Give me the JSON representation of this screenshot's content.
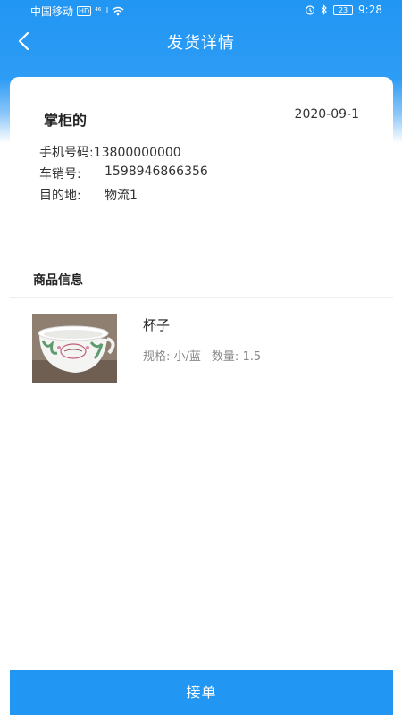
{
  "status_bar": {
    "carrier": "中国移动",
    "hd_badge": "HD",
    "signal": "⁴⁶.ıl",
    "battery": "23",
    "time": "9:28"
  },
  "nav": {
    "title": "发货详情"
  },
  "shipment": {
    "seller_name": "掌柜的",
    "date": "2020-09-1",
    "phone_label": "手机号码:",
    "phone_value": "13800000000",
    "vehicle_label": "车销号:",
    "vehicle_value": "1598946866356",
    "destination_label": "目的地:",
    "destination_value": "物流1"
  },
  "goods": {
    "section_title": "商品信息",
    "items": [
      {
        "name": "杯子",
        "spec_label": "规格:",
        "spec_value": "小/蓝",
        "qty_label": "数量:",
        "qty_value": "1.5"
      }
    ]
  },
  "actions": {
    "accept_label": "接单"
  },
  "colors": {
    "primary": "#2196f3",
    "text_dark": "#222222",
    "text_muted": "#888888"
  }
}
